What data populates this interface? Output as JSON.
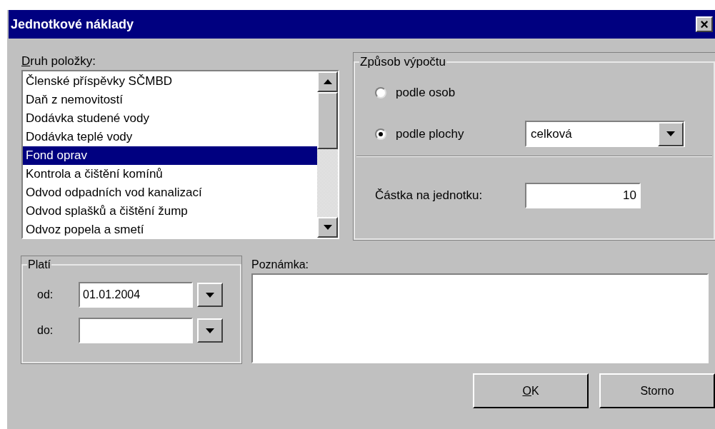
{
  "window": {
    "title": "Jednotkové náklady",
    "close": "×"
  },
  "item_type": {
    "label": "Druh položky:",
    "mnemonic_underlined": true,
    "items": [
      {
        "label": "Členské příspěvky SČMBD",
        "selected": false
      },
      {
        "label": "Daň z nemovitostí",
        "selected": false
      },
      {
        "label": "Dodávka studené vody",
        "selected": false
      },
      {
        "label": "Dodávka teplé vody",
        "selected": false
      },
      {
        "label": "Fond oprav",
        "selected": true
      },
      {
        "label": "Kontrola a čištění komínů",
        "selected": false
      },
      {
        "label": "Odvod odpadních vod kanalizací",
        "selected": false
      },
      {
        "label": "Odvod splašků a čištění žump",
        "selected": false
      },
      {
        "label": "Odvoz popela a smetí",
        "selected": false
      }
    ]
  },
  "calculation": {
    "title": "Způsob výpočtu",
    "options": [
      {
        "label": "podle osob",
        "selected": false
      },
      {
        "label": "podle plochy",
        "selected": true,
        "combo_value": "celková"
      }
    ],
    "amount_label": "Částka na jednotku:",
    "amount_value": "10"
  },
  "validity": {
    "title": "Platí",
    "rows": [
      {
        "label": "od:",
        "value": "01.01.2004"
      },
      {
        "label": "do:"
      }
    ]
  },
  "note": {
    "label": "Poznámka:"
  },
  "buttons": [
    {
      "label": "OK",
      "mnemonic_underlined": true
    },
    {
      "label": "Storno",
      "mnemonic_underlined": false
    }
  ]
}
